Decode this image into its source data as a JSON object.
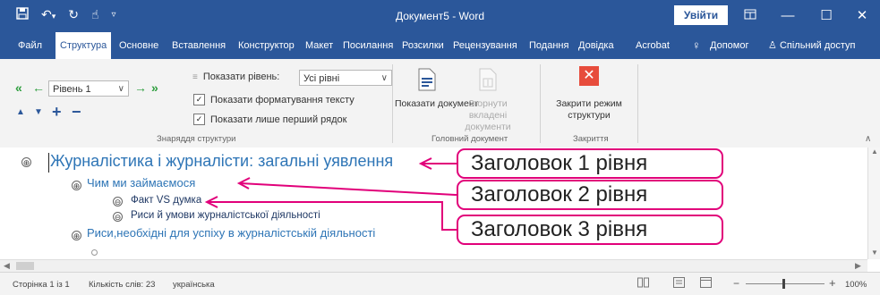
{
  "titlebar": {
    "doc_title": "Документ5 - Word",
    "signin_label": "Увійти",
    "qat_icons": [
      "save-icon",
      "undo-icon",
      "redo-icon",
      "touch-mode-icon",
      "customize-qat-icon"
    ]
  },
  "menu": {
    "tabs": [
      "Файл",
      "Структура",
      "Основне",
      "Вставлення",
      "Конструктор",
      "Макет",
      "Посилання",
      "Розсилки",
      "Рецензування",
      "Подання",
      "Довідка",
      "Acrobat"
    ],
    "active_tab": "Структура",
    "tell_me": "Допомог",
    "share": "Спільний доступ"
  },
  "ribbon": {
    "outline_tools": {
      "level_select": "Рівень 1",
      "show_level_label": "Показати рівень:",
      "show_level_value": "Усі рівні",
      "show_formatting": "Показати форматування тексту",
      "show_first_line": "Показати лише перший рядок",
      "group_label": "Знаряддя структури"
    },
    "master_document": {
      "show_document": "Показати документ",
      "collapse_subdocs": "Згорнути вкладені документи",
      "group_label": "Головний документ"
    },
    "close": {
      "close_outline": "Закрити режим структури",
      "group_label": "Закриття"
    }
  },
  "outline": {
    "items": [
      {
        "level": 1,
        "text": "Журналістика і журналісти: загальні уявлення",
        "symbol": "⊕"
      },
      {
        "level": 2,
        "text": "Чим ми займаємося",
        "symbol": "⊕"
      },
      {
        "level": 3,
        "text": "Факт VS думка",
        "symbol": "⊖"
      },
      {
        "level": 3,
        "text": "Риси й умови журналістської діяльності",
        "symbol": "⊖"
      },
      {
        "level": 2,
        "text": "Риси,необхідні для успіху в журналістській діяльності",
        "symbol": "⊕"
      }
    ]
  },
  "callouts": [
    "Заголовок 1 рівня",
    "Заголовок 2 рівня",
    "Заголовок 3 рівня"
  ],
  "status": {
    "page": "Сторінка 1 із 1",
    "words": "Кількість слів: 23",
    "language": "українська",
    "zoom": "100%"
  },
  "colors": {
    "brand": "#2b579a",
    "callout_border": "#e1007a",
    "heading": "#2e75b6",
    "close_red": "#e74c3c"
  }
}
